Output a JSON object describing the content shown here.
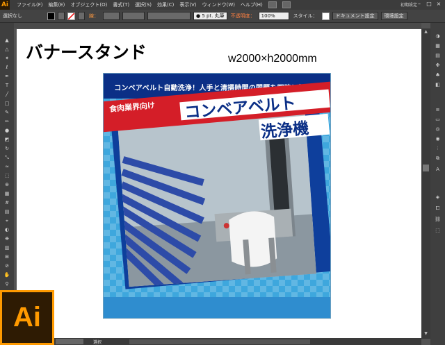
{
  "app": {
    "logo_text": "Ai",
    "workspace": "初期設定",
    "window_controls": [
      "–",
      "□",
      "×"
    ]
  },
  "menu": {
    "items": [
      "ファイル(F)",
      "編集(E)",
      "オブジェクト(O)",
      "書式(T)",
      "選択(S)",
      "効果(C)",
      "表示(V)",
      "ウィンドウ(W)",
      "ヘルプ(H)"
    ]
  },
  "control_bar": {
    "selection_status": "選択なし",
    "stroke_label": "線：",
    "stroke_profile": "● 5 pt. 丸筆",
    "opacity_label": "不透明度：",
    "opacity_value": "100%",
    "style_label": "スタイル：",
    "doc_settings_button": "ドキュメント設定",
    "env_settings_button": "環境設定"
  },
  "artboard": {
    "heading": "バナースタンド",
    "size_text": "w2000×h2000mm"
  },
  "banner": {
    "tagline": "コンベアベルト自動洗浄！人手と清掃時間の問題を同時に解決！",
    "industry_label": "食肉業界向け",
    "product_line1": "コンベアベルト",
    "product_line2": "洗浄機",
    "colors": {
      "navy": "#0b2f86",
      "red": "#d41e28",
      "sky": "#3ea7dd"
    }
  },
  "status_bar": {
    "tool_text": "選択"
  },
  "badge": {
    "text": "Ai"
  },
  "tools": [
    "selection-tool-icon",
    "direct-selection-tool-icon",
    "magic-wand-icon",
    "lasso-icon",
    "pen-tool-icon",
    "type-tool-icon",
    "line-tool-icon",
    "rectangle-tool-icon",
    "paintbrush-icon",
    "pencil-icon",
    "blob-brush-icon",
    "eraser-icon",
    "rotate-tool-icon",
    "scale-tool-icon",
    "warp-tool-icon",
    "free-transform-icon",
    "shape-builder-icon",
    "perspective-grid-icon",
    "mesh-tool-icon",
    "gradient-tool-icon",
    "eyedropper-icon",
    "blend-tool-icon",
    "symbol-sprayer-icon",
    "graph-tool-icon",
    "artboard-tool-icon",
    "slice-tool-icon",
    "hand-tool-icon",
    "zoom-tool-icon",
    "fill-stroke-icon"
  ],
  "panels": [
    "color-panel-icon",
    "color-guide-icon",
    "swatches-icon",
    "brushes-icon",
    "symbols-icon",
    "graphic-styles-icon",
    "stroke-panel-icon",
    "gradient-panel-icon",
    "transparency-icon",
    "appearance-icon",
    "align-icon",
    "pathfinder-icon",
    "type-panel-icon",
    "layers-icon",
    "artboards-icon",
    "links-icon",
    "transform-icon"
  ]
}
